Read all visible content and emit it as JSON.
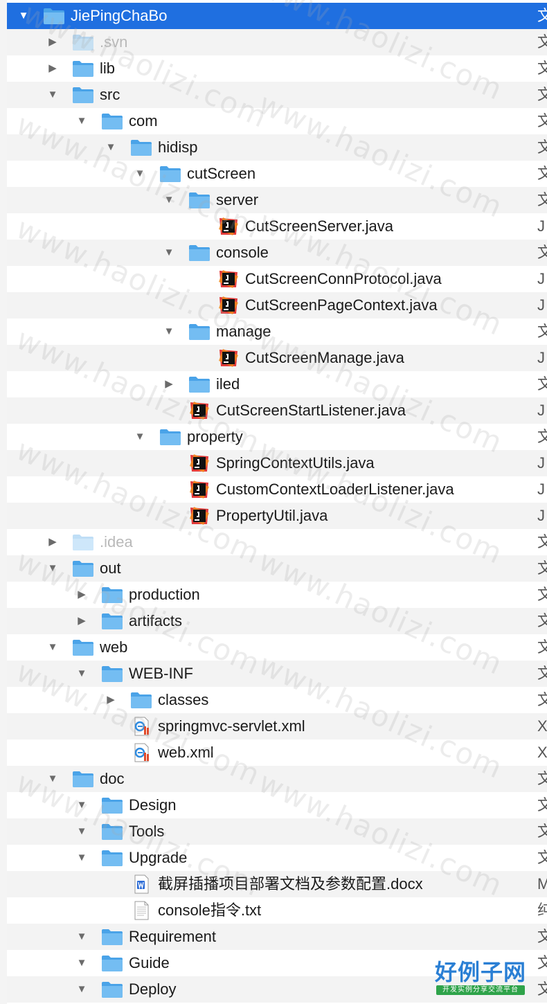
{
  "tree": [
    {
      "name": "JiePingChaBo",
      "depth": 0,
      "icon": "folder",
      "arrow": "down",
      "kind": "文",
      "selected": true
    },
    {
      "name": ".svn",
      "depth": 1,
      "icon": "folder",
      "arrow": "right",
      "kind": "文",
      "dim": true
    },
    {
      "name": "lib",
      "depth": 1,
      "icon": "folder",
      "arrow": "right",
      "kind": "文"
    },
    {
      "name": "src",
      "depth": 1,
      "icon": "folder",
      "arrow": "down",
      "kind": "文"
    },
    {
      "name": "com",
      "depth": 2,
      "icon": "folder",
      "arrow": "down",
      "kind": "文"
    },
    {
      "name": "hidisp",
      "depth": 3,
      "icon": "folder",
      "arrow": "down",
      "kind": "文"
    },
    {
      "name": "cutScreen",
      "depth": 4,
      "icon": "folder",
      "arrow": "down",
      "kind": "文"
    },
    {
      "name": "server",
      "depth": 5,
      "icon": "folder",
      "arrow": "down",
      "kind": "文"
    },
    {
      "name": "CutScreenServer.java",
      "depth": 6,
      "icon": "java",
      "arrow": "",
      "kind": "J"
    },
    {
      "name": "console",
      "depth": 5,
      "icon": "folder",
      "arrow": "down",
      "kind": "文"
    },
    {
      "name": "CutScreenConnProtocol.java",
      "depth": 6,
      "icon": "java",
      "arrow": "",
      "kind": "J"
    },
    {
      "name": "CutScreenPageContext.java",
      "depth": 6,
      "icon": "java",
      "arrow": "",
      "kind": "J"
    },
    {
      "name": "manage",
      "depth": 5,
      "icon": "folder",
      "arrow": "down",
      "kind": "文"
    },
    {
      "name": "CutScreenManage.java",
      "depth": 6,
      "icon": "java",
      "arrow": "",
      "kind": "J"
    },
    {
      "name": "iled",
      "depth": 5,
      "icon": "folder",
      "arrow": "right",
      "kind": "文"
    },
    {
      "name": "CutScreenStartListener.java",
      "depth": 5,
      "icon": "java",
      "arrow": "",
      "kind": "J"
    },
    {
      "name": "property",
      "depth": 4,
      "icon": "folder",
      "arrow": "down",
      "kind": "文"
    },
    {
      "name": "SpringContextUtils.java",
      "depth": 5,
      "icon": "java",
      "arrow": "",
      "kind": "J"
    },
    {
      "name": "CustomContextLoaderListener.java",
      "depth": 5,
      "icon": "java",
      "arrow": "",
      "kind": "J"
    },
    {
      "name": "PropertyUtil.java",
      "depth": 5,
      "icon": "java",
      "arrow": "",
      "kind": "J"
    },
    {
      "name": ".idea",
      "depth": 1,
      "icon": "folder",
      "arrow": "right",
      "kind": "文",
      "dim": true
    },
    {
      "name": "out",
      "depth": 1,
      "icon": "folder",
      "arrow": "down",
      "kind": "文"
    },
    {
      "name": "production",
      "depth": 2,
      "icon": "folder",
      "arrow": "right",
      "kind": "文"
    },
    {
      "name": "artifacts",
      "depth": 2,
      "icon": "folder",
      "arrow": "right",
      "kind": "文"
    },
    {
      "name": "web",
      "depth": 1,
      "icon": "folder",
      "arrow": "down",
      "kind": "文"
    },
    {
      "name": "WEB-INF",
      "depth": 2,
      "icon": "folder",
      "arrow": "down",
      "kind": "文"
    },
    {
      "name": "classes",
      "depth": 3,
      "icon": "folder",
      "arrow": "right",
      "kind": "文"
    },
    {
      "name": "springmvc-servlet.xml",
      "depth": 3,
      "icon": "xml",
      "arrow": "",
      "kind": "X"
    },
    {
      "name": "web.xml",
      "depth": 3,
      "icon": "xml",
      "arrow": "",
      "kind": "X"
    },
    {
      "name": "doc",
      "depth": 1,
      "icon": "folder",
      "arrow": "down",
      "kind": "文"
    },
    {
      "name": "Design",
      "depth": 2,
      "icon": "folder",
      "arrow": "down",
      "kind": "文"
    },
    {
      "name": "Tools",
      "depth": 2,
      "icon": "folder",
      "arrow": "down",
      "kind": "文"
    },
    {
      "name": "Upgrade",
      "depth": 2,
      "icon": "folder",
      "arrow": "down",
      "kind": "文"
    },
    {
      "name": "截屏插播项目部署文档及参数配置.docx",
      "depth": 3,
      "icon": "docx",
      "arrow": "",
      "kind": "M"
    },
    {
      "name": "console指令.txt",
      "depth": 3,
      "icon": "txt",
      "arrow": "",
      "kind": "纯"
    },
    {
      "name": "Requirement",
      "depth": 2,
      "icon": "folder",
      "arrow": "down",
      "kind": "文"
    },
    {
      "name": "Guide",
      "depth": 2,
      "icon": "folder",
      "arrow": "down",
      "kind": "文"
    },
    {
      "name": "Deploy",
      "depth": 2,
      "icon": "folder",
      "arrow": "down",
      "kind": "文"
    }
  ],
  "watermark": {
    "text": "www.haolizi.com"
  },
  "logo": {
    "title": "好例子网",
    "subtitle": "开发实例分享交流平台"
  }
}
